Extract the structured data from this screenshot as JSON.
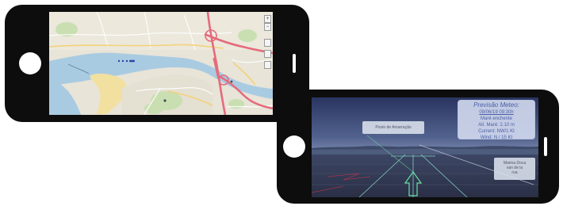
{
  "map_view": {
    "zoom_in": "+",
    "zoom_out": "−",
    "controls": [
      "layers-icon",
      "locate-icon",
      "fullscreen-icon"
    ]
  },
  "ar_view": {
    "label_left": "Posto de Amarração",
    "label_right": "Marina Doca\nvan de la\nrua",
    "meteo": {
      "title": "Previsão Meteo:",
      "date": "09/06/19 09:30h",
      "line1": "Maré enchente",
      "line2": "Alt. Maré: 2.10 m",
      "line3": "Current: NW/1 Kt",
      "line4": "Wind: N / 15 Kt"
    }
  },
  "colors": {
    "phone_body": "#0d0d0d",
    "water": "#a9cbe2",
    "land": "#e8e4d8",
    "park": "#c9dfb2",
    "beach": "#f2e0a0",
    "highway": "#e46b7c",
    "meteo_text": "#4b5da6"
  }
}
